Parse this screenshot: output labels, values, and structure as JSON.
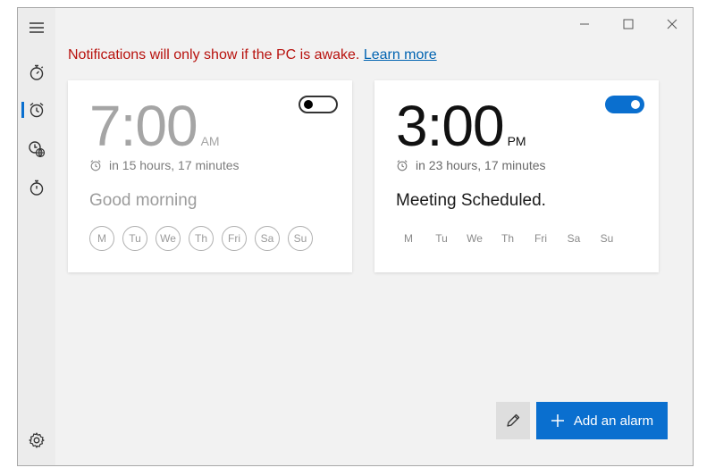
{
  "window": {
    "buttons": {
      "minimize": "minimize-icon",
      "maximize": "maximize-icon",
      "close": "close-icon"
    }
  },
  "sidebar": {
    "items": [
      {
        "icon": "hamburger-menu-icon",
        "name": "menu"
      },
      {
        "icon": "timer-icon",
        "name": "timer"
      },
      {
        "icon": "alarm-clock-icon",
        "name": "alarm",
        "active": true
      },
      {
        "icon": "world-clock-icon",
        "name": "world-clock"
      },
      {
        "icon": "stopwatch-icon",
        "name": "stopwatch"
      },
      {
        "icon": "settings-gear-icon",
        "name": "settings"
      }
    ],
    "accent_color": "#0a6fcf"
  },
  "notice": {
    "text": "Notifications will only show if the PC is awake.",
    "link": "Learn more",
    "color": "#b8120e",
    "link_color": "#0063b1"
  },
  "alarms": [
    {
      "time": "7:00",
      "ampm": "AM",
      "remaining": "in 15 hours, 17 minutes",
      "label": "Good morning",
      "enabled": false,
      "days": [
        "M",
        "Tu",
        "We",
        "Th",
        "Fri",
        "Sa",
        "Su"
      ]
    },
    {
      "time": "3:00",
      "ampm": "PM",
      "remaining": "in 23 hours, 17 minutes",
      "label": "Meeting Scheduled.",
      "enabled": true,
      "days": [
        "M",
        "Tu",
        "We",
        "Th",
        "Fri",
        "Sa",
        "Su"
      ]
    }
  ],
  "actions": {
    "edit_icon": "pencil-icon",
    "add_label": "Add an alarm",
    "add_icon": "plus-icon",
    "add_color": "#0a6fcf"
  }
}
